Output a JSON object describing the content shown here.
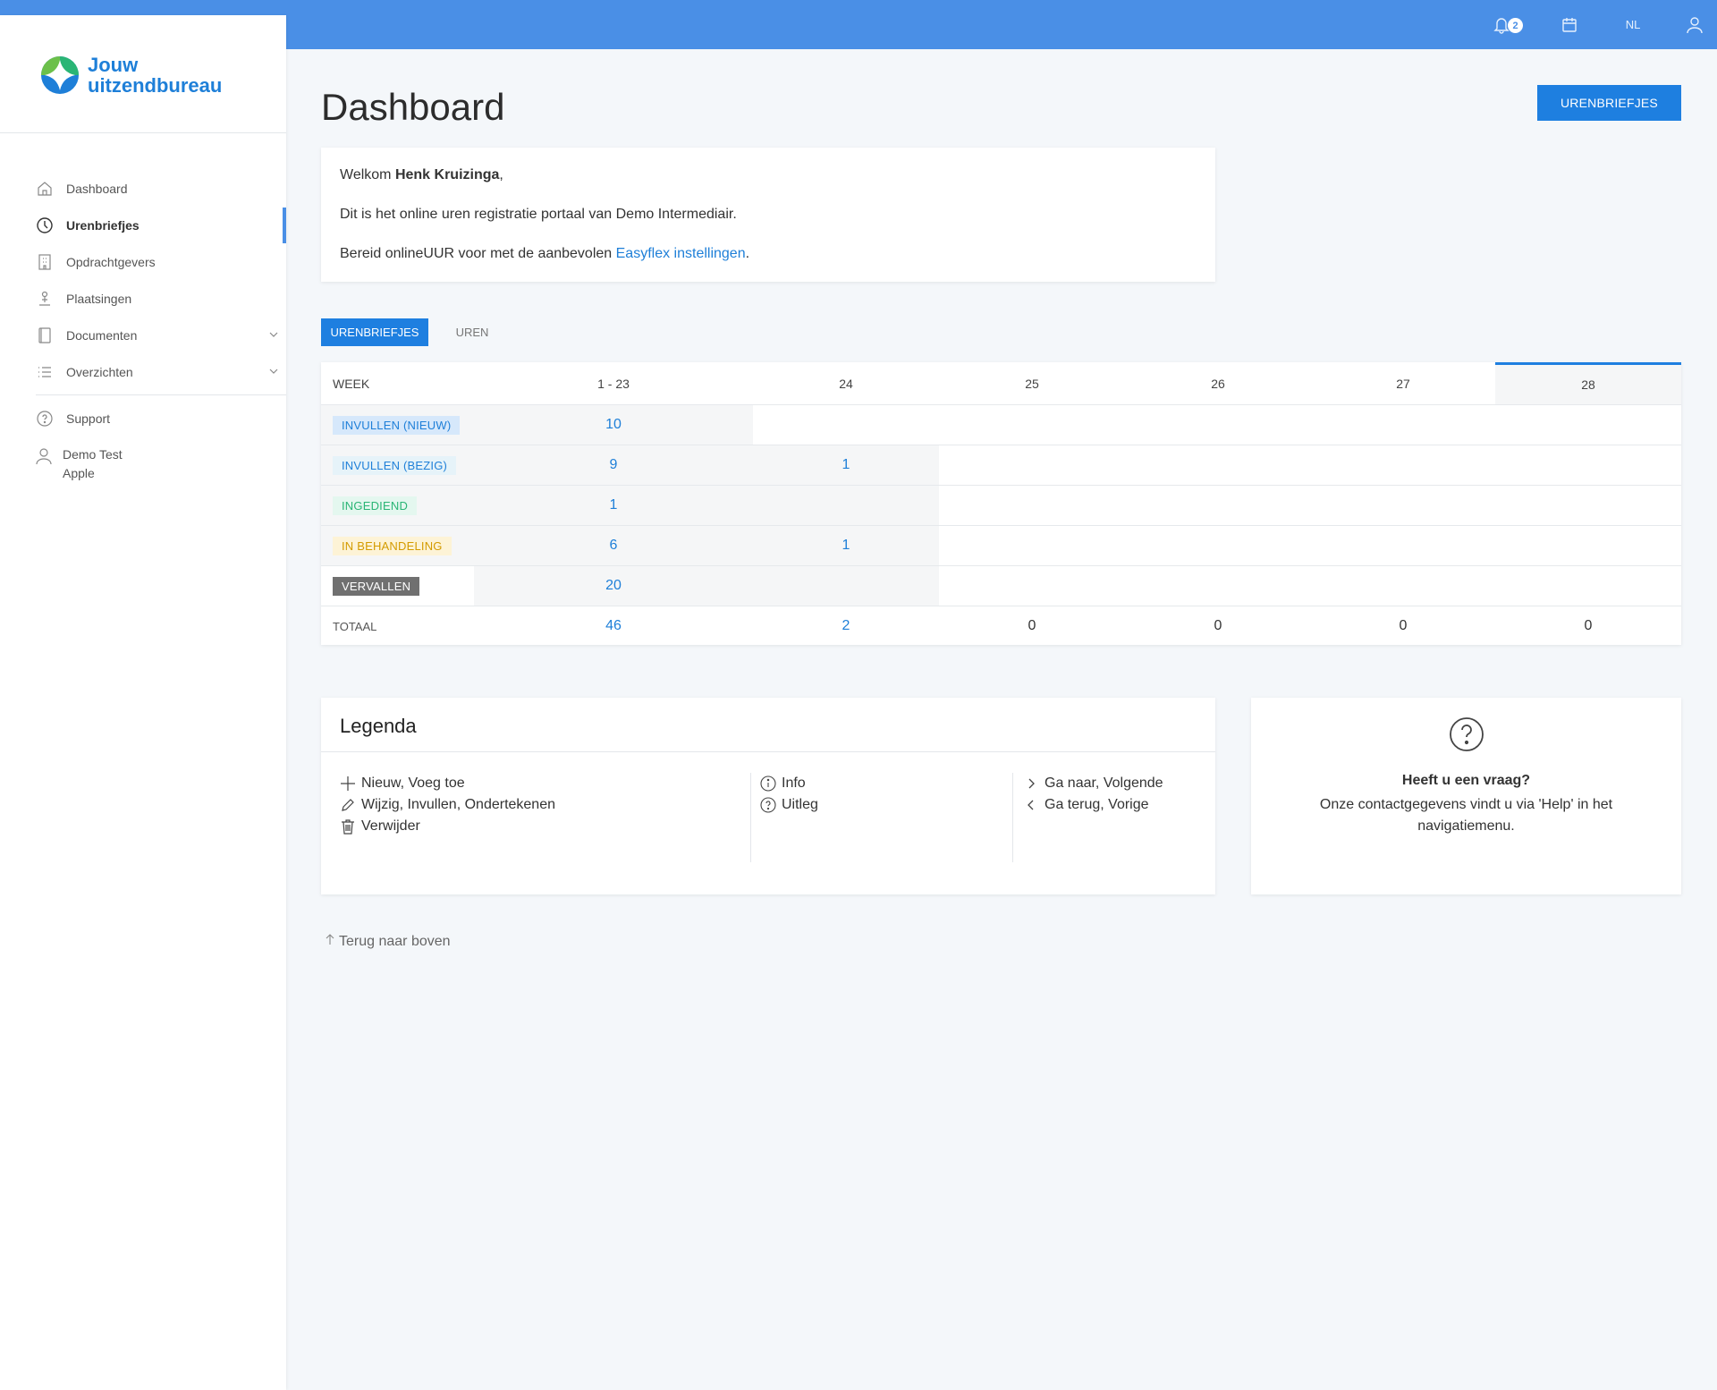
{
  "header": {
    "notifications_count": "2",
    "language": "NL",
    "icons": [
      "bell-icon",
      "calendar-icon",
      "user-icon"
    ],
    "color": "#4a8fe6"
  },
  "sidebar": {
    "logo": {
      "line1": "Jouw",
      "line2": "uitzendbureau"
    },
    "items": [
      {
        "label": "Dashboard",
        "icon": "home-icon"
      },
      {
        "label": "Urenbriefjes",
        "icon": "clock-icon",
        "active": true
      },
      {
        "label": "Opdrachtgevers",
        "icon": "building-icon"
      },
      {
        "label": "Plaatsingen",
        "icon": "person-pin-icon"
      },
      {
        "label": "Documenten",
        "icon": "document-icon"
      },
      {
        "label": "Overzichten",
        "icon": "list-icon"
      }
    ],
    "support": "Support",
    "user": {
      "line1": "Demo Test",
      "line2": "Apple"
    }
  },
  "main": {
    "title": "Dashboard",
    "action_button": "URENBRIEFJES",
    "welcome": {
      "greeting": "Welkom ",
      "name": "Henk Kruizinga",
      "comma": ",",
      "line2": "Dit is het online uren registratie portaal van Demo Intermediair.",
      "line3_prefix": "Bereid onlineUUR voor met de aanbevolen ",
      "line3_link": "Easyflex instellingen",
      "line3_suffix": "."
    },
    "tabs": [
      "URENBRIEFJES",
      "UREN"
    ],
    "table": {
      "headers": [
        "WEEK",
        "1 - 23",
        "24",
        "25",
        "26",
        "27",
        "28"
      ],
      "rows": [
        {
          "label": "INVULLEN (NIEUW)",
          "values": [
            "10",
            "",
            "",
            "",
            "",
            ""
          ]
        },
        {
          "label": "INVULLEN (BEZIG)",
          "values": [
            "9",
            "1",
            "",
            "",
            "",
            ""
          ]
        },
        {
          "label": "INGEDIEND",
          "values": [
            "1",
            "",
            "",
            "",
            "",
            ""
          ]
        },
        {
          "label": "IN BEHANDELING",
          "values": [
            "6",
            "1",
            "",
            "",
            "",
            ""
          ]
        },
        {
          "label": "VERVALLEN",
          "values": [
            "20",
            "",
            "",
            "",
            "",
            ""
          ]
        }
      ],
      "total": {
        "label": "TOTAAL",
        "values": [
          "46",
          "2",
          "0",
          "0",
          "0",
          "0"
        ]
      }
    },
    "legend": {
      "title": "Legenda",
      "col1": [
        "Nieuw, Voeg toe",
        "Wijzig, Invullen, Ondertekenen",
        "Verwijder"
      ],
      "col2": [
        "Info",
        "Uitleg"
      ],
      "col3": [
        "Ga naar, Volgende",
        "Ga terug, Vorige"
      ]
    },
    "help": {
      "title": "Heeft u een vraag?",
      "text": "Onze contactgegevens vindt u via 'Help' in het navigatiemenu."
    },
    "back_to_top": "Terug naar boven"
  }
}
